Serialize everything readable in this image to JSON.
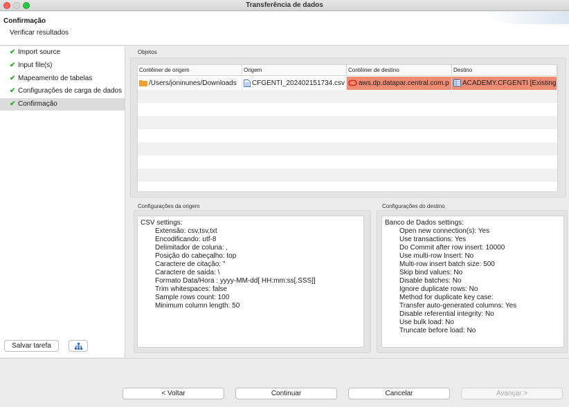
{
  "window": {
    "title": "Transferência de dados"
  },
  "header": {
    "title": "Confirmação",
    "subtitle": "Verificar resultados"
  },
  "nav": {
    "items": [
      {
        "label": "Import source",
        "done": true
      },
      {
        "label": "Input file(s)",
        "done": true
      },
      {
        "label": "Mapeamento de tabelas",
        "done": true
      },
      {
        "label": "Configurações de carga de dados",
        "done": true
      },
      {
        "label": "Confirmação",
        "done": true,
        "active": true
      }
    ],
    "save_label": "Salvar tarefa",
    "extra_icon": "hierarchy-icon"
  },
  "objects": {
    "label": "Objetos",
    "columns": [
      "Contêiner de origem",
      "Origem",
      "Contêiner de destino",
      "Destino"
    ],
    "rows": [
      {
        "source_container": "/Users/joninunes/Downloads",
        "source": "CFGENTI_202402151734.csv",
        "target_container": "aws.dp.datapar.central.com.p",
        "target": "ACADEMY.CFGENTI [Existing]"
      }
    ]
  },
  "source_settings": {
    "label": "Configurações da origem",
    "heading": "CSV settings:",
    "lines": [
      "Extensão: csv,tsv,txt",
      "Encodificando: utf-8",
      "Delimitador de coluna: ,",
      "Posição do cabeçalho: top",
      "Caractere de citação: \"",
      "Caractere de saída: \\",
      "Formato Data/Hora : yyyy-MM-dd[ HH:mm:ss[.SSS]]",
      "Trim whitespaces: false",
      "Sample rows count: 100",
      "Minimum column length: 50"
    ]
  },
  "target_settings": {
    "label": "Configurações do destino",
    "heading": "Banco de Dados settings:",
    "lines": [
      "Open new connection(s): Yes",
      "Use transactions: Yes",
      "Do Commit after row insert: 10000",
      "Use multi-row Insert: No",
      "Multi-row insert batch size: 500",
      "Skip bind values: No",
      "Disable batches: No",
      "Ignore duplicate rows: No",
      "Method for duplicate key case:",
      "Transfer auto-generated columns: Yes",
      "Disable referential integrity: No",
      "Use bulk load: No",
      "Truncate before load: No"
    ]
  },
  "footer": {
    "back_label": "< Voltar",
    "continue_label": "Continuar",
    "cancel_label": "Cancelar",
    "next_label": "Avançar >"
  },
  "colors": {
    "check": "#2fa82f",
    "highlight": "#f08c74",
    "folder": "#f0a030",
    "accent": "#2a67c9"
  }
}
